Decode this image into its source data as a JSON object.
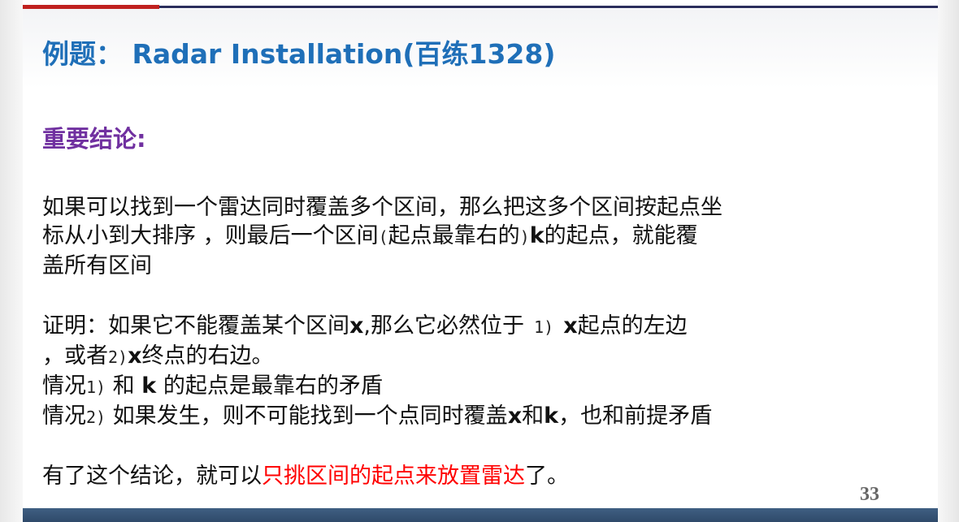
{
  "title": "例题： Radar Installation(百练1328)",
  "subtitle": "重要结论:",
  "conclusion": {
    "line1": "如果可以找到一个雷达同时覆盖多个区间，那么把这多个区间按起点坐",
    "line2_a": "标从小到大排序 ，则最后一个区间",
    "line2_b": "(",
    "line2_c": "起点最靠右的",
    "line2_d": ")",
    "line2_e": "k",
    "line2_f": "的起点，就能覆",
    "line3": "盖所有区间"
  },
  "proof": {
    "l1_a": "证明：如果它不能覆盖某个区间",
    "l1_x": "x",
    "l1_b": ",那么它必然位于",
    "l1_num": " 1) ",
    "l1_x2": "x",
    "l1_c": "起点的左边",
    "l2_a": "，或者",
    "l2_num": "2)",
    "l2_x": "x",
    "l2_b": "终点的右边。",
    "l3_a": "情况",
    "l3_num": "1)",
    "l3_b": " 和 ",
    "l3_k": "k",
    "l3_c": " 的起点是最靠右的矛盾",
    "l4_a": "情况",
    "l4_num": "2)",
    "l4_b": " 如果发生，则不可能找到一个点同时覆盖",
    "l4_x": "x",
    "l4_c": "和",
    "l4_k": "k",
    "l4_d": "，也和前提矛盾"
  },
  "final": {
    "a": "有了这个结论，就可以",
    "highlight": "只挑区间的起点来放置雷达",
    "b": "了。"
  },
  "page_number": "33",
  "colors": {
    "title": "#1f6fb8",
    "subtitle": "#7030a0",
    "highlight": "#ff0000",
    "top_bar_red": "#c0211f",
    "top_bar_navy": "#2b2e5c",
    "bottom_bar": "#3f5f82"
  }
}
